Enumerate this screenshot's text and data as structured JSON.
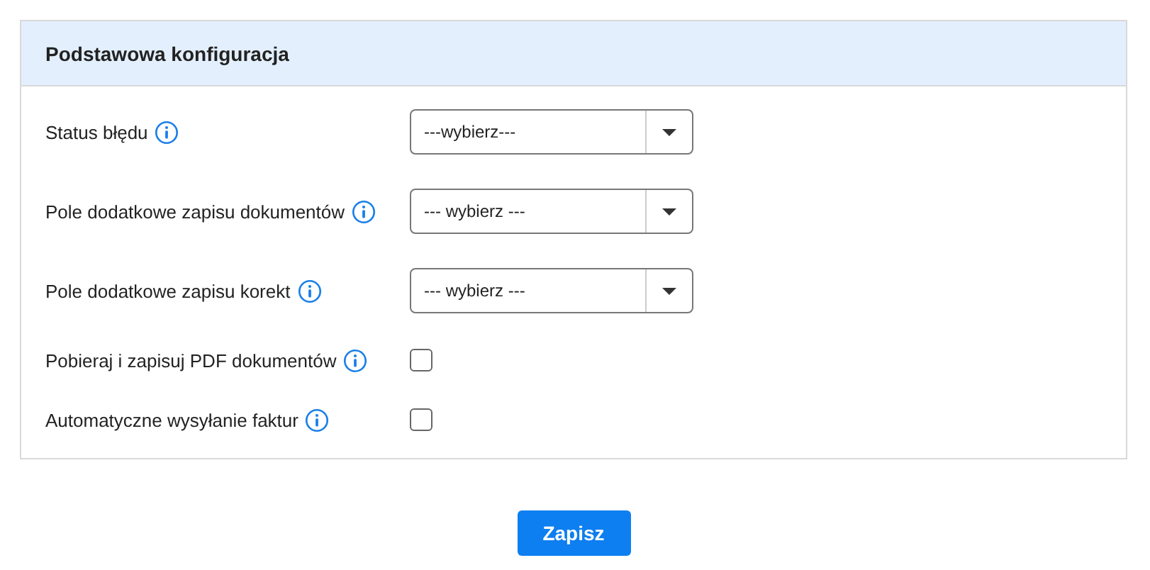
{
  "panel": {
    "title": "Podstawowa konfiguracja"
  },
  "fields": [
    {
      "kind": "select",
      "label": "Status błędu",
      "value": "---wybierz---"
    },
    {
      "kind": "select",
      "label": "Pole dodatkowe zapisu dokumentów",
      "value": "--- wybierz ---"
    },
    {
      "kind": "select",
      "label": "Pole dodatkowe zapisu korekt",
      "value": "--- wybierz ---"
    },
    {
      "kind": "checkbox",
      "label": "Pobieraj i zapisuj PDF dokumentów",
      "checked": false
    },
    {
      "kind": "checkbox",
      "label": "Automatyczne wysyłanie faktur",
      "checked": false
    }
  ],
  "save_button": "Zapisz"
}
